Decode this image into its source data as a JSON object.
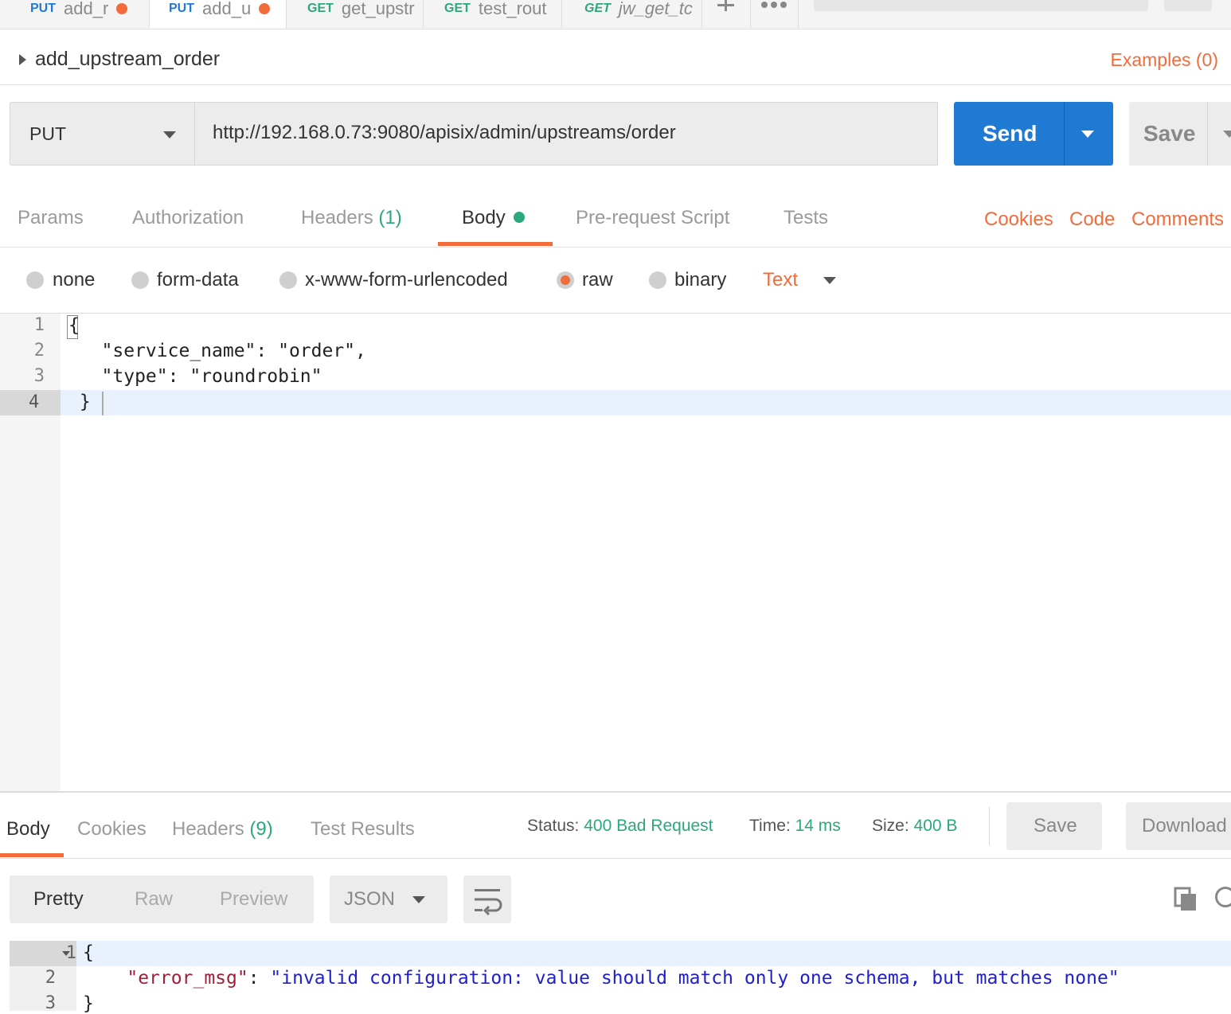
{
  "tabs": [
    {
      "method": "PUT",
      "title": "add_r",
      "unsaved": true
    },
    {
      "method": "PUT",
      "title": "add_u",
      "unsaved": true
    },
    {
      "method": "GET",
      "title": "get_upstr",
      "unsaved": false
    },
    {
      "method": "GET",
      "title": "test_rout",
      "unsaved": false
    },
    {
      "method": "GET",
      "title": "jw_get_tc",
      "unsaved": false
    }
  ],
  "request": {
    "name": "add_upstream_order",
    "examples_label": "Examples (0)",
    "method": "PUT",
    "url": "http://192.168.0.73:9080/apisix/admin/upstreams/order",
    "send_label": "Send",
    "save_label": "Save"
  },
  "request_tabs": {
    "params": "Params",
    "authorization": "Authorization",
    "headers": "Headers",
    "headers_count": "(1)",
    "body": "Body",
    "prerequest": "Pre-request Script",
    "tests": "Tests",
    "cookies": "Cookies",
    "code": "Code",
    "comments": "Comments"
  },
  "body_types": {
    "none": "none",
    "form_data": "form-data",
    "urlencoded": "x-www-form-urlencoded",
    "raw": "raw",
    "binary": "binary",
    "selected": "raw",
    "text_type": "Text"
  },
  "editor": {
    "line_numbers": [
      "1",
      "2",
      "3",
      "4"
    ],
    "lines": [
      "{",
      "   \"service_name\": \"order\",",
      "   \"type\": \"roundrobin\"",
      " }"
    ]
  },
  "response": {
    "tabs": {
      "body": "Body",
      "cookies": "Cookies",
      "headers": "Headers",
      "headers_count": "(9)",
      "test_results": "Test Results"
    },
    "status_label": "Status:",
    "status_value": "400 Bad Request",
    "time_label": "Time:",
    "time_value": "14 ms",
    "size_label": "Size:",
    "size_value": "400 B",
    "save_label": "Save",
    "download_label": "Download",
    "formats": {
      "pretty": "Pretty",
      "raw": "Raw",
      "preview": "Preview"
    },
    "language": "JSON",
    "line_numbers": [
      "1",
      "2",
      "3"
    ],
    "json": {
      "open": "{",
      "key": "\"error_msg\"",
      "colon": ": ",
      "value": "\"invalid configuration: value should match only one schema, but matches none\"",
      "close": "}"
    }
  },
  "colors": {
    "accent_orange": "#f26b3a",
    "send_blue": "#1f7ad3",
    "status_green": "#2aa87e"
  },
  "icons": [
    "plus-icon",
    "more-icon",
    "caret-right-icon",
    "chevron-down-icon",
    "wrap-icon",
    "copy-icon",
    "search-icon"
  ]
}
